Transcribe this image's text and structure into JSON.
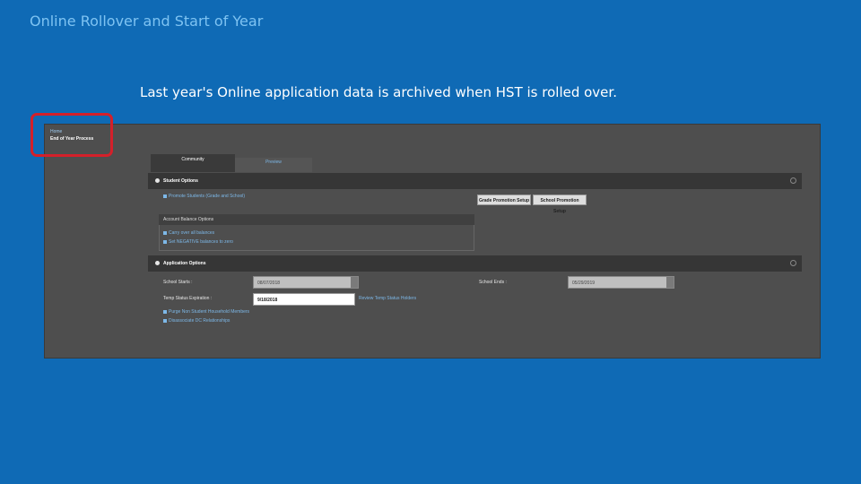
{
  "slide": {
    "title": "Online Rollover and Start of Year",
    "caption": "Last year's Online application data is archived when HST is rolled over."
  },
  "breadcrumb": {
    "link": "Home",
    "current": "End of Year Process"
  },
  "tabs": [
    {
      "label": "Community"
    },
    {
      "label": "Preview"
    }
  ],
  "student_options": {
    "header": "Student Options",
    "promote_link": "Promote Students (Grade and School)",
    "grade_button": "Grade Promotion Setup",
    "school_button": "School Promotion Setup",
    "account_balance": {
      "header": "Account Balance Options",
      "carry_link": "Carry over all balances",
      "set_negative_link": "Set NEGATIVE balances to zero"
    }
  },
  "application_options": {
    "header": "Application Options",
    "school_starts_label": "School Starts :",
    "school_starts_value": "08/07/2018",
    "school_ends_label": "School Ends :",
    "school_ends_value": "05/29/2019",
    "temp_status_label": "Temp Status Expiration :",
    "temp_status_value": "9/18/2018",
    "review_link": "Review Temp Status Holders",
    "purge_link": "Purge Non Student Household Members",
    "disassociate_link": "Disassociate DC Relationships"
  },
  "colors": {
    "background": "#0f6ab5",
    "title": "#7ec3f2",
    "highlight": "#d4202a",
    "link": "#7db8e8"
  }
}
